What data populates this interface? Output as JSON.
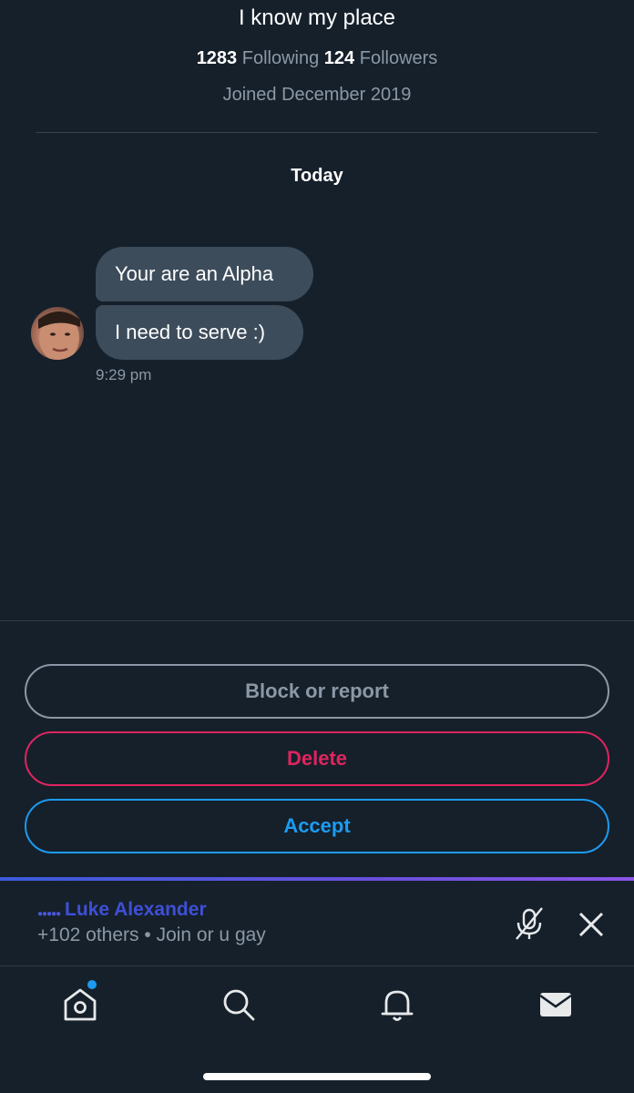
{
  "profile": {
    "bio": "I know my place",
    "following_count": "1283",
    "following_label": "Following",
    "followers_count": "124",
    "followers_label": "Followers",
    "joined": "Joined December 2019"
  },
  "conversation": {
    "day_label": "Today",
    "messages": [
      {
        "text": "Your are an Alpha"
      },
      {
        "text": "I need to serve :)"
      }
    ],
    "timestamp": "9:29 pm"
  },
  "actions": {
    "block_label": "Block or report",
    "delete_label": "Delete",
    "accept_label": "Accept"
  },
  "space": {
    "host": "Luke Alexander",
    "listeners": "+102 others",
    "separator": "•",
    "title": "Join or u gay"
  },
  "tabs": [
    {
      "icon": "home-icon"
    },
    {
      "icon": "search-icon"
    },
    {
      "icon": "bell-icon"
    },
    {
      "icon": "mail-icon"
    }
  ],
  "colors": {
    "background": "#15202b",
    "bubble": "#3d4c5b",
    "muted_text": "#8b98a5",
    "delete_red": "#e0245e",
    "accept_blue": "#1d9bf0",
    "space_purple": "#3f4fd6"
  }
}
